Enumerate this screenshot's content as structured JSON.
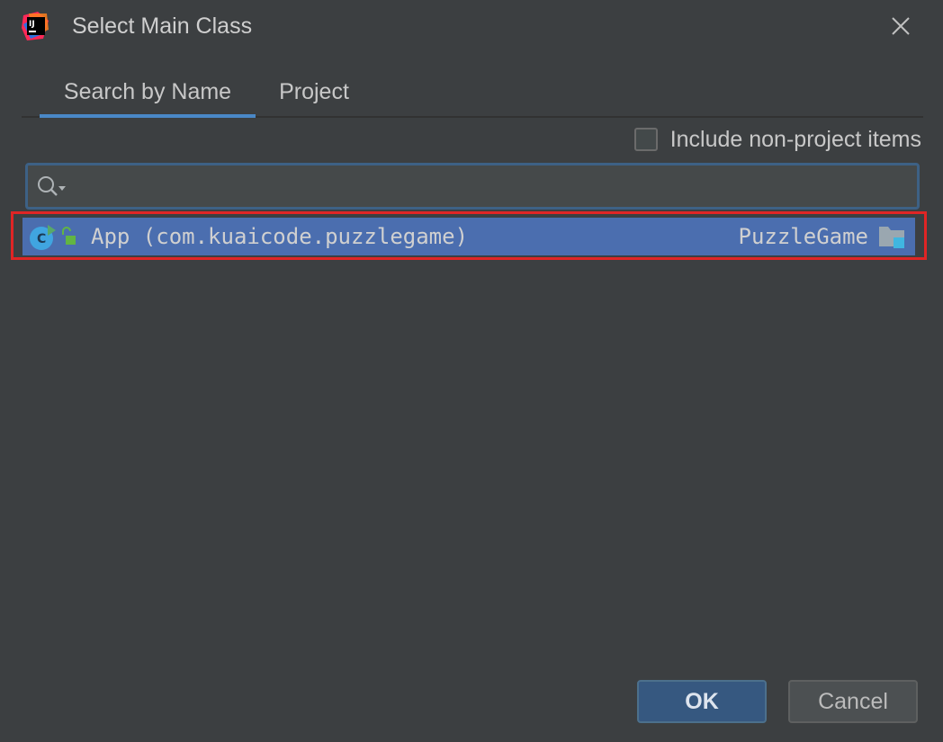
{
  "window": {
    "title": "Select Main Class",
    "app_icon": "intellij-idea-icon",
    "close_icon": "close-icon"
  },
  "tabs": [
    {
      "label": "Search by Name",
      "active": true
    },
    {
      "label": "Project",
      "active": false
    }
  ],
  "options": {
    "include_non_project_label": "Include non-project items",
    "include_non_project_checked": false
  },
  "search": {
    "value": "",
    "placeholder": "",
    "icon": "search-icon"
  },
  "results": [
    {
      "name": "App (com.kuaicode.puzzlegame)",
      "module": "PuzzleGame",
      "selected": true,
      "icon": "runnable-class-icon",
      "visibility_icon": "public-lock-icon",
      "module_icon": "module-folder-icon"
    }
  ],
  "buttons": {
    "ok": "OK",
    "cancel": "Cancel"
  },
  "colors": {
    "background": "#3c3f41",
    "selection": "#4b6eaf",
    "highlight_border": "#e02525",
    "accent": "#4a88c7"
  }
}
